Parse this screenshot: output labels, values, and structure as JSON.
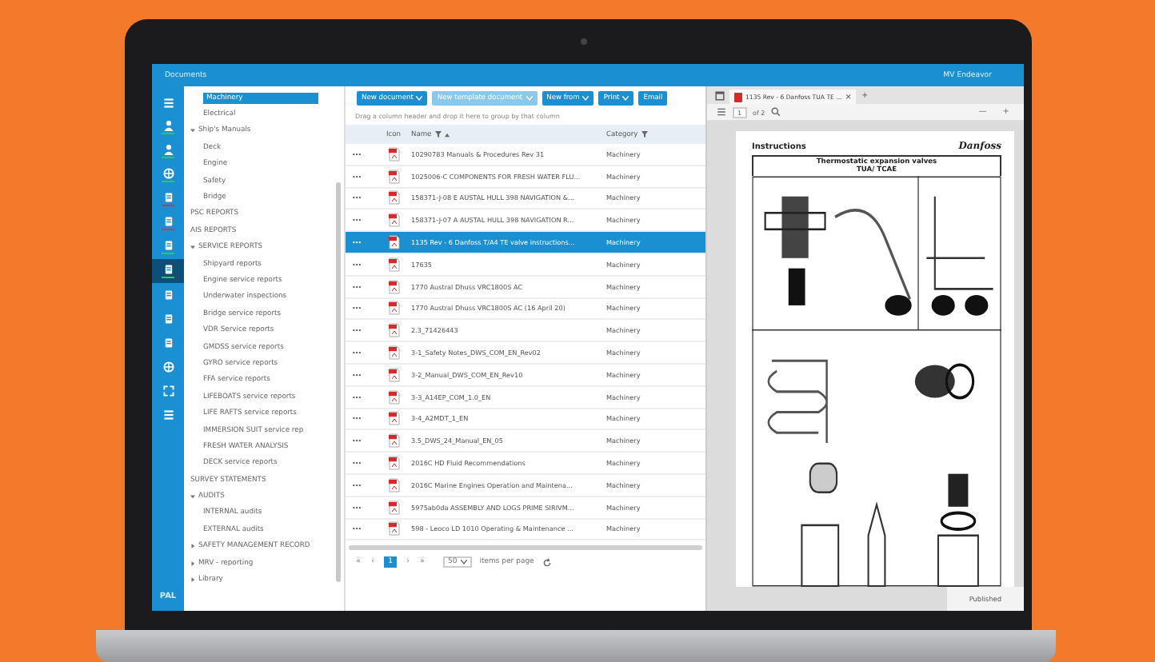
{
  "app_bar": {
    "title": "Documents",
    "vessel": "MV Endeavor"
  },
  "rail": [
    {
      "selected": false
    },
    {
      "selected": false,
      "color": "#2ecc40"
    },
    {
      "selected": false,
      "color": "#2ecc40"
    },
    {
      "selected": false,
      "color": "#2ecc40"
    },
    {
      "selected": false,
      "color": "#e0303a"
    },
    {
      "selected": false,
      "color": "#e0303a"
    },
    {
      "selected": false,
      "color": "#2ecc40"
    },
    {
      "selected": true,
      "color": "#2ecc40"
    },
    {
      "selected": false
    },
    {
      "selected": false
    },
    {
      "selected": false
    },
    {
      "selected": false
    },
    {
      "selected": false
    },
    {
      "selected": false
    }
  ],
  "rail_footer": "PAL",
  "tree": {
    "continued_children": [
      {
        "label": "Machinery",
        "selected": true
      },
      {
        "label": "Electrical",
        "selected": false
      }
    ],
    "items": [
      {
        "label": "Ship's Manuals",
        "selected": false,
        "expanded": true,
        "children": [
          {
            "label": "Deck",
            "selected": false
          },
          {
            "label": "Engine",
            "selected": false
          },
          {
            "label": "Safety",
            "selected": false
          },
          {
            "label": "Bridge",
            "selected": false
          }
        ]
      },
      {
        "label": "PSC REPORTS",
        "selected": false
      },
      {
        "label": "AIS REPORTS",
        "selected": false
      },
      {
        "label": "SERVICE REPORTS",
        "selected": false,
        "expanded": true,
        "children": [
          {
            "label": "Shipyard reports",
            "selected": false
          },
          {
            "label": "Engine service reports",
            "selected": false
          },
          {
            "label": "Underwater inspections",
            "selected": false
          },
          {
            "label": "Bridge service reports",
            "selected": false
          },
          {
            "label": "VDR Service reports",
            "selected": false
          },
          {
            "label": "GMDSS service reports",
            "selected": false
          },
          {
            "label": "GYRO service reports",
            "selected": false
          },
          {
            "label": "FFA service reports",
            "selected": false
          },
          {
            "label": "LIFEBOATS service reports",
            "selected": false
          },
          {
            "label": "LIFE RAFTS service reports",
            "selected": false
          },
          {
            "label": "IMMERSION SUIT service rep",
            "selected": false
          },
          {
            "label": "FRESH WATER ANALYSIS",
            "selected": false
          },
          {
            "label": "DECK service reports",
            "selected": false
          }
        ]
      },
      {
        "label": "SURVEY STATEMENTS",
        "selected": false
      },
      {
        "label": "AUDITS",
        "selected": false,
        "expanded": true,
        "children": [
          {
            "label": "INTERNAL audits",
            "selected": false
          },
          {
            "label": "EXTERNAL audits",
            "selected": false
          }
        ]
      },
      {
        "label": "SAFETY MANAGEMENT RECORD",
        "selected": false,
        "expanded": false
      },
      {
        "label": "MRV - reporting",
        "selected": false,
        "expanded": false
      },
      {
        "label": "Library",
        "selected": false,
        "expanded": false
      }
    ]
  },
  "toolbar": [
    {
      "label": "New document",
      "dropdown": true,
      "disabled": false
    },
    {
      "label": "New template document",
      "dropdown": true,
      "disabled": true
    },
    {
      "label": "New from",
      "dropdown": true,
      "disabled": false
    },
    {
      "label": "Print",
      "dropdown": true,
      "disabled": false
    },
    {
      "label": "Email",
      "dropdown": false,
      "disabled": false
    }
  ],
  "group_hint": "Drag a column header and drop it here to group by that column",
  "table": {
    "columns": [
      {
        "label": "Icon",
        "filter": false,
        "sort": false
      },
      {
        "label": "Name",
        "filter": true,
        "sort": true
      },
      {
        "label": "Category",
        "filter": true,
        "sort": false
      }
    ],
    "rows": [
      {
        "actions": "•••",
        "name": "10290783 Manuals & Procedures Rev 31",
        "category": "Machinery",
        "selected": false
      },
      {
        "actions": "•••",
        "name": "1025006-C COMPONENTS FOR FRESH WATER FLU...",
        "category": "Machinery",
        "selected": false
      },
      {
        "actions": "•••",
        "name": "158371-J-08 E AUSTAL HULL 398 NAVIGATION &...",
        "category": "Machinery",
        "selected": false
      },
      {
        "actions": "•••",
        "name": "158371-J-07 A AUSTAL HULL 398 NAVIGATION R...",
        "category": "Machinery",
        "selected": false
      },
      {
        "actions": "•••",
        "name": "1135 Rev - 6 Danfoss T/A4 TE valve instructions...",
        "category": "Machinery",
        "selected": true
      },
      {
        "actions": "•••",
        "name": "17635",
        "category": "Machinery",
        "selected": false
      },
      {
        "actions": "•••",
        "name": "1770 Austral Dhuss VRC1800S AC",
        "category": "Machinery",
        "selected": false
      },
      {
        "actions": "•••",
        "name": "1770 Austral Dhuss VRC1800S AC (16 April 20)",
        "category": "Machinery",
        "selected": false
      },
      {
        "actions": "•••",
        "name": "2.3_71426443",
        "category": "Machinery",
        "selected": false
      },
      {
        "actions": "•••",
        "name": "3-1_Safety Notes_DWS_COM_EN_Rev02",
        "category": "Machinery",
        "selected": false
      },
      {
        "actions": "•••",
        "name": "3-2_Manual_DWS_COM_EN_Rev10",
        "category": "Machinery",
        "selected": false
      },
      {
        "actions": "•••",
        "name": "3-3_A14EP_COM_1.0_EN",
        "category": "Machinery",
        "selected": false
      },
      {
        "actions": "•••",
        "name": "3-4_A2MDT_1_EN",
        "category": "Machinery",
        "selected": false
      },
      {
        "actions": "•••",
        "name": "3.5_DWS_24_Manual_EN_05",
        "category": "Machinery",
        "selected": false
      },
      {
        "actions": "•••",
        "name": "2016C HD Fluid Recommendations",
        "category": "Machinery",
        "selected": false
      },
      {
        "actions": "•••",
        "name": "2016C Marine Engines Operation and Maintena...",
        "category": "Machinery",
        "selected": false
      },
      {
        "actions": "•••",
        "name": "5975ab0da ASSEMBLY AND LOGS PRIME SIRIVM...",
        "category": "Machinery",
        "selected": false
      },
      {
        "actions": "•••",
        "name": "598 - Leoco LD 1010 Operating & Maintenance ...",
        "category": "Machinery",
        "selected": false
      }
    ]
  },
  "pager": {
    "first": "«",
    "prev": "‹",
    "pages": [
      {
        "label": "1",
        "selected": true
      }
    ],
    "next": "›",
    "last": "»",
    "page_size": "50",
    "page_size_label": "items per page"
  },
  "viewer": {
    "tab": {
      "title": "1135 Rev - 6 Danfoss TUA TE ...",
      "close": "×"
    },
    "new_tab": "+",
    "page": "1",
    "page_count": "of 2",
    "zoom_out": "—",
    "zoom_in": "+",
    "document": {
      "heading": "Instructions",
      "logo": "Danfoss",
      "title": "Thermostatic expansion valves",
      "subtitle": "TUA/ TCAE"
    },
    "status": "Published"
  }
}
